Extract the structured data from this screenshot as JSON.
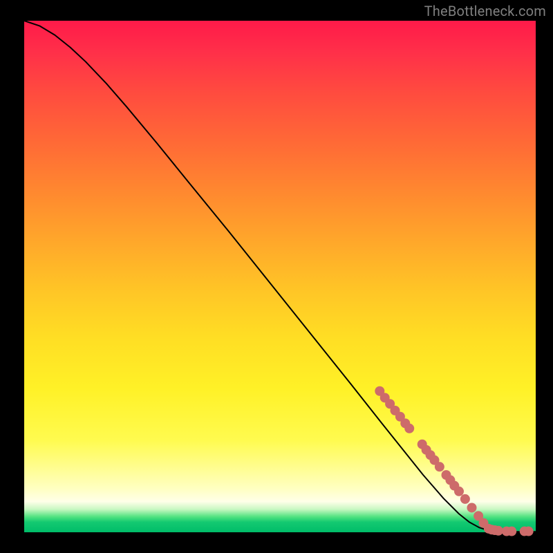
{
  "attribution": "TheBottleneck.com",
  "chart_data": {
    "type": "line",
    "title": "",
    "xlabel": "",
    "ylabel": "",
    "xlim": [
      0,
      100
    ],
    "ylim": [
      0,
      100
    ],
    "curve": [
      {
        "x": 0,
        "y": 100.0
      },
      {
        "x": 3,
        "y": 99.0
      },
      {
        "x": 6,
        "y": 97.2
      },
      {
        "x": 9,
        "y": 94.8
      },
      {
        "x": 12,
        "y": 92.0
      },
      {
        "x": 16,
        "y": 87.8
      },
      {
        "x": 20,
        "y": 83.2
      },
      {
        "x": 26,
        "y": 76.0
      },
      {
        "x": 32,
        "y": 68.6
      },
      {
        "x": 40,
        "y": 58.8
      },
      {
        "x": 48,
        "y": 48.8
      },
      {
        "x": 56,
        "y": 38.8
      },
      {
        "x": 64,
        "y": 28.8
      },
      {
        "x": 70,
        "y": 21.2
      },
      {
        "x": 74,
        "y": 16.2
      },
      {
        "x": 78,
        "y": 11.2
      },
      {
        "x": 82,
        "y": 6.6
      },
      {
        "x": 85,
        "y": 3.6
      },
      {
        "x": 87,
        "y": 2.0
      },
      {
        "x": 89,
        "y": 0.9
      },
      {
        "x": 91,
        "y": 0.3
      },
      {
        "x": 94,
        "y": 0.1
      },
      {
        "x": 100,
        "y": 0.1
      }
    ],
    "markers": [
      {
        "x": 69.5,
        "y": 27.6
      },
      {
        "x": 70.5,
        "y": 26.3
      },
      {
        "x": 71.5,
        "y": 25.1
      },
      {
        "x": 72.5,
        "y": 23.8
      },
      {
        "x": 73.5,
        "y": 22.6
      },
      {
        "x": 74.5,
        "y": 21.3
      },
      {
        "x": 75.3,
        "y": 20.3
      },
      {
        "x": 77.8,
        "y": 17.2
      },
      {
        "x": 78.6,
        "y": 16.1
      },
      {
        "x": 79.4,
        "y": 15.1
      },
      {
        "x": 80.2,
        "y": 14.1
      },
      {
        "x": 81.2,
        "y": 12.8
      },
      {
        "x": 82.5,
        "y": 11.2
      },
      {
        "x": 83.3,
        "y": 10.2
      },
      {
        "x": 84.1,
        "y": 9.1
      },
      {
        "x": 85.0,
        "y": 8.0
      },
      {
        "x": 86.2,
        "y": 6.5
      },
      {
        "x": 87.5,
        "y": 4.8
      },
      {
        "x": 88.8,
        "y": 3.2
      },
      {
        "x": 89.8,
        "y": 1.8
      },
      {
        "x": 90.8,
        "y": 0.7
      },
      {
        "x": 91.4,
        "y": 0.5
      },
      {
        "x": 92.0,
        "y": 0.4
      },
      {
        "x": 92.7,
        "y": 0.3
      },
      {
        "x": 94.3,
        "y": 0.2
      },
      {
        "x": 95.3,
        "y": 0.2
      },
      {
        "x": 97.8,
        "y": 0.2
      },
      {
        "x": 98.6,
        "y": 0.2
      }
    ],
    "marker_color": "#cd6b6a",
    "curve_color": "#000000"
  }
}
